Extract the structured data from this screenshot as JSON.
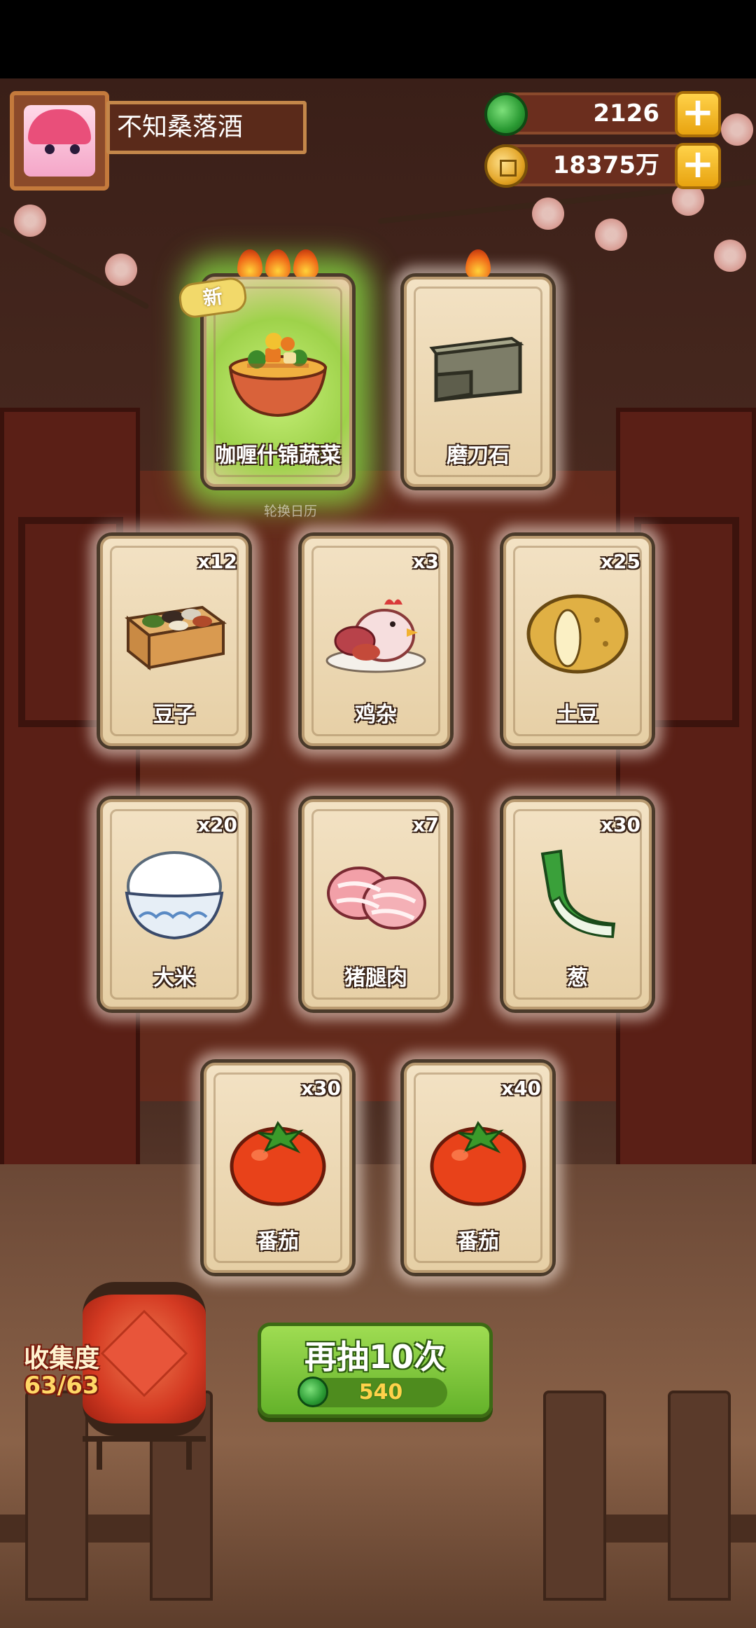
{
  "player": {
    "name": "不知桑落酒"
  },
  "currencies": {
    "jade": {
      "value": "2126",
      "icon": "jade-icon"
    },
    "coins": {
      "value": "18375万",
      "icon": "coin-icon"
    }
  },
  "featured_cards": [
    {
      "name": "咖喱什锦蔬菜",
      "flames": 3,
      "is_new": true,
      "new_label": "新",
      "icon": "curry-vegetable-bowl-icon"
    },
    {
      "name": "磨刀石",
      "flames": 1,
      "is_new": false,
      "icon": "whetstone-icon"
    }
  ],
  "calendar_label": "轮换日历",
  "cards": [
    {
      "name": "豆子",
      "count": "x12",
      "icon": "beans-box-icon"
    },
    {
      "name": "鸡杂",
      "count": "x3",
      "icon": "chicken-giblets-icon"
    },
    {
      "name": "土豆",
      "count": "x25",
      "icon": "potato-icon"
    },
    {
      "name": "大米",
      "count": "x20",
      "icon": "rice-bowl-icon"
    },
    {
      "name": "猪腿肉",
      "count": "x7",
      "icon": "pork-leg-icon"
    },
    {
      "name": "葱",
      "count": "x30",
      "icon": "scallion-icon"
    },
    {
      "name": "番茄",
      "count": "x30",
      "icon": "tomato-icon"
    },
    {
      "name": "番茄",
      "count": "x40",
      "icon": "tomato-icon"
    }
  ],
  "collection": {
    "label": "收集度",
    "value": "63/63"
  },
  "draw_again": {
    "label": "再抽10次",
    "cost": "540",
    "cost_icon": "jade-icon"
  },
  "colors": {
    "draw_button": "#64b22a",
    "special_glow": "#8ce646",
    "card_bg": "#e6cfa5",
    "lantern": "#d43a22"
  }
}
